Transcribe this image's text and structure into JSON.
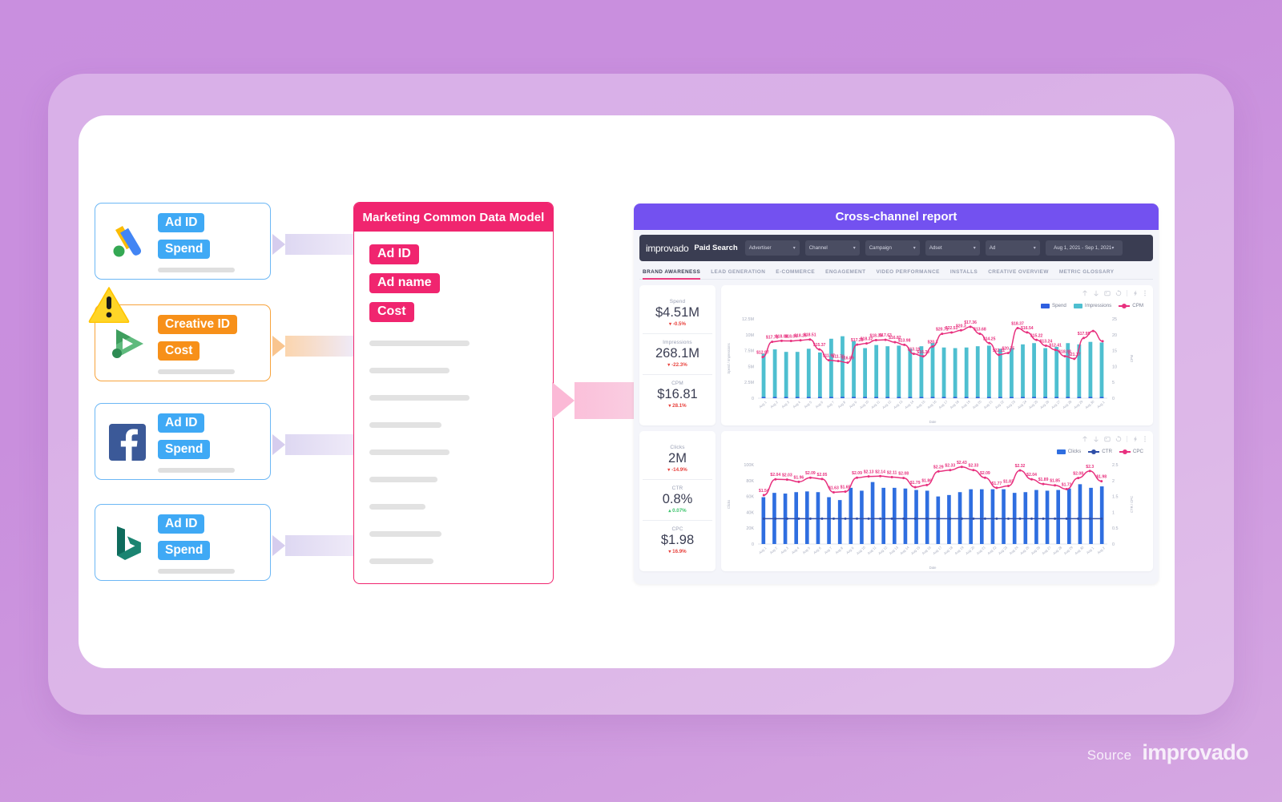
{
  "colors": {
    "bg_purple": "#c98fdf",
    "cdm_pink": "#f0256f",
    "source_blue": "#3fa9f5",
    "warn_orange": "#f79019",
    "dash_purple": "#7351f0",
    "spend_blue": "#2f5fe0",
    "impressions_teal": "#4ebfd0",
    "cpm_pink": "#e8307e",
    "clicks_blue": "#2f6ee0",
    "positive_green": "#3ec46d",
    "negative_red": "#e8413c"
  },
  "sources": [
    {
      "name": "Google Ads",
      "icon": "google-ads-logo",
      "style": "blue",
      "warning": false,
      "fields": [
        "Ad ID",
        "Spend"
      ]
    },
    {
      "name": "Display & Video 360",
      "icon": "dv360-logo",
      "style": "orange",
      "warning": true,
      "fields": [
        "Creative ID",
        "Cost"
      ]
    },
    {
      "name": "Facebook",
      "icon": "facebook-logo",
      "style": "blue",
      "warning": false,
      "fields": [
        "Ad ID",
        "Spend"
      ]
    },
    {
      "name": "Microsoft Bing",
      "icon": "bing-logo",
      "style": "blue",
      "warning": false,
      "fields": [
        "Ad ID",
        "Spend"
      ]
    }
  ],
  "cdm": {
    "title": "Marketing Common Data Model",
    "fields": [
      "Ad ID",
      "Ad name",
      "Cost"
    ],
    "placeholder_widths": [
      125,
      100,
      125,
      90,
      100,
      85,
      70,
      90,
      80,
      75
    ]
  },
  "dashboard": {
    "title": "Cross-channel report",
    "brand": "improvado",
    "section": "Paid Search",
    "filters": [
      {
        "label": "Advertiser"
      },
      {
        "label": "Channel"
      },
      {
        "label": "Campaign"
      },
      {
        "label": "Adset"
      },
      {
        "label": "Ad"
      }
    ],
    "date_range": "Aug 1, 2021 - Sep 1, 2021",
    "tabs": [
      {
        "label": "BRAND AWARENESS",
        "active": true
      },
      {
        "label": "LEAD GENERATION",
        "active": false
      },
      {
        "label": "E-COMMERCE",
        "active": false
      },
      {
        "label": "ENGAGEMENT",
        "active": false
      },
      {
        "label": "VIDEO PERFORMANCE",
        "active": false
      },
      {
        "label": "INSTALLS",
        "active": false
      },
      {
        "label": "CREATIVE OVERVIEW",
        "active": false
      },
      {
        "label": "METRIC GLOSSARY",
        "active": false
      }
    ],
    "kpi_cards": [
      {
        "metrics": [
          {
            "label": "Spend",
            "value": "$4.51M",
            "delta": "-0.5%",
            "direction": "down"
          },
          {
            "label": "Impressions",
            "value": "268.1M",
            "delta": "-22.3%",
            "direction": "down"
          },
          {
            "label": "CPM",
            "value": "$16.81",
            "delta": "28.1%",
            "direction": "down"
          }
        ]
      },
      {
        "metrics": [
          {
            "label": "Clicks",
            "value": "2M",
            "delta": "-14.9%",
            "direction": "down"
          },
          {
            "label": "CTR",
            "value": "0.8%",
            "delta": "0.07%",
            "direction": "up"
          },
          {
            "label": "CPC",
            "value": "$1.98",
            "delta": "16.9%",
            "direction": "down"
          }
        ]
      }
    ],
    "chart_toolbar_icons": [
      "arrow-up-icon",
      "arrow-down-icon",
      "image-icon",
      "refresh-icon",
      "bolt-icon",
      "more-icon"
    ]
  },
  "chart_data": [
    {
      "type": "bar",
      "id": "spend-impressions-cpm-chart",
      "title": "",
      "xlabel": "Date",
      "ylabel": "Spend / Impressions",
      "y2label": "CPM",
      "ylim": [
        0,
        12500000
      ],
      "y2lim": [
        0,
        25
      ],
      "yticks": [
        "0",
        "2.5M",
        "5M",
        "7.5M",
        "10M",
        "12.5M"
      ],
      "y2ticks": [
        "0",
        "5",
        "10",
        "15",
        "20",
        "25"
      ],
      "grid": false,
      "legend": [
        {
          "name": "Spend",
          "color": "#2f5fe0",
          "kind": "bar"
        },
        {
          "name": "Impressions",
          "color": "#4ebfd0",
          "kind": "bar"
        },
        {
          "name": "CPM",
          "color": "#e8307e",
          "kind": "line"
        }
      ],
      "series": [
        {
          "name": "Impressions",
          "kind": "bar",
          "color": "#4ebfd0",
          "values": [
            7.1,
            7.8,
            7.4,
            7.4,
            7.9,
            7.3,
            9.5,
            9.9,
            9.1,
            8.0,
            8.5,
            8.3,
            8.4,
            7.9,
            8.3,
            8.8,
            8.1,
            8.0,
            8.1,
            8.3,
            8.4,
            7.9,
            8.0,
            8.6,
            8.8,
            8.0,
            8.2,
            8.8,
            8.6,
            9.0,
            8.9
          ]
        },
        {
          "name": "Spend",
          "kind": "bar",
          "color": "#2f5fe0",
          "values": [
            0.16,
            0.18,
            0.17,
            0.17,
            0.18,
            0.17,
            0.2,
            0.21,
            0.2,
            0.18,
            0.19,
            0.19,
            0.19,
            0.18,
            0.19,
            0.2,
            0.18,
            0.18,
            0.18,
            0.19,
            0.19,
            0.18,
            0.18,
            0.19,
            0.2,
            0.18,
            0.19,
            0.2,
            0.19,
            0.2,
            0.2
          ]
        },
        {
          "name": "CPM",
          "kind": "line",
          "color": "#e8307e",
          "values": [
            12.97,
            17.78,
            18.08,
            18.04,
            18.26,
            18.51,
            15.37,
            11.97,
            11.7,
            11.2,
            16.89,
            17.28,
            18.32,
            18.39,
            17.63,
            16.82,
            13.98,
            13.19,
            16.3,
            20.3,
            20.71,
            21.4,
            22.51,
            20.3,
            17.36,
            13.68,
            14.25,
            22.11,
            20.75,
            18.37,
            16.54,
            15.22,
            13.24,
            12.41,
            18.98,
            21.17,
            17.95
          ],
          "labels": [
            "$12.97",
            "$17.78",
            "$18.08",
            "$18.04",
            "$18.26",
            "$18.51",
            "$15.37",
            "$11.97",
            "$11.70",
            "$16.89",
            "$17.28",
            "$18.32",
            "$18.39",
            "$17.63",
            "$16.82",
            "$13.98",
            "$13.19",
            "$16.30",
            "$20.3",
            "$20.71",
            "$22.51",
            "$20.3",
            "$17.36",
            "$13.68",
            "$14.25",
            "$22.11",
            "$20.75",
            "$18.37",
            "$16.54",
            "$15.22",
            "$13.24",
            "$12.41",
            "$18.98",
            "$21.17",
            "$17.95"
          ]
        }
      ]
    },
    {
      "type": "bar",
      "id": "clicks-ctr-cpc-chart",
      "title": "",
      "xlabel": "Date",
      "ylabel": "Clicks",
      "y2label": "CTR / CPC",
      "ylim": [
        0,
        100000
      ],
      "y2lim": [
        0,
        2.5
      ],
      "yticks": [
        "0",
        "20K",
        "40K",
        "60K",
        "80K",
        "100K"
      ],
      "y2ticks": [
        "0",
        "0.5",
        "1",
        "1.5",
        "2",
        "2.5"
      ],
      "grid": false,
      "legend": [
        {
          "name": "Clicks",
          "color": "#2f6ee0",
          "kind": "bar"
        },
        {
          "name": "CTR",
          "color": "#2f4fa8",
          "kind": "line"
        },
        {
          "name": "CPC",
          "color": "#e8307e",
          "kind": "line"
        }
      ],
      "series": [
        {
          "name": "Clicks",
          "kind": "bar",
          "color": "#2f6ee0",
          "values": [
            65,
            71,
            70,
            72,
            73,
            72,
            65,
            61,
            78,
            74,
            86,
            78,
            78,
            77,
            75,
            74,
            66,
            68,
            72,
            76,
            76,
            76,
            76,
            71,
            72,
            75,
            74,
            75,
            77,
            83,
            78,
            80
          ]
        },
        {
          "name": "CPC",
          "kind": "line",
          "color": "#e8307e",
          "values": [
            1.54,
            2.04,
            2.03,
            1.96,
            2.09,
            2.05,
            1.63,
            1.65,
            2.09,
            2.13,
            2.14,
            2.11,
            2.08,
            1.79,
            1.86,
            2.29,
            2.33,
            2.43,
            2.33,
            2.09,
            1.77,
            1.83,
            2.32,
            2.04,
            1.89,
            1.85,
            1.73,
            2.08,
            2.3,
            1.98
          ],
          "labels": [
            "$1.54",
            "$2.04",
            "$2.03",
            "$1.96",
            "$2.09",
            "$2.05",
            "$1.63",
            "$1.65",
            "$2.09",
            "$2.13",
            "$2.14",
            "$2.11",
            "$2.08",
            "$1.79",
            "$1.86",
            "$2.29",
            "$2.33",
            "$2.43",
            "$2.33",
            "$2.09",
            "$1.77",
            "$1.83",
            "$2.32",
            "$2.04",
            "$1.89",
            "$1.85",
            "$1.73",
            "$2.08",
            "$2.3",
            "$1.98"
          ]
        },
        {
          "name": "CTR",
          "kind": "line",
          "color": "#2f4fa8",
          "values": [
            0.8,
            0.8,
            0.8,
            0.8,
            0.8,
            0.8,
            0.8,
            0.8,
            0.8,
            0.8,
            0.8,
            0.8,
            0.8,
            0.8,
            0.8,
            0.8,
            0.8,
            0.8,
            0.8,
            0.8,
            0.8,
            0.8,
            0.8,
            0.8,
            0.8,
            0.8,
            0.8,
            0.8,
            0.8,
            0.8
          ]
        }
      ]
    }
  ],
  "watermark": {
    "source_label": "Source",
    "brand": "improvado"
  }
}
